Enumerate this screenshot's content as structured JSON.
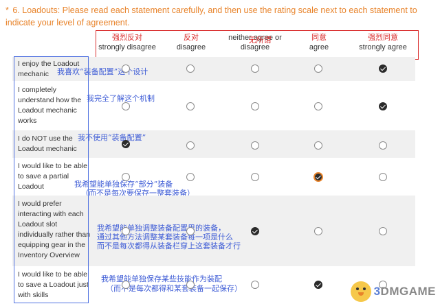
{
  "question": {
    "marker": "*",
    "text": "6. Loadouts: Please read each statement carefully, and then use the rating scale next to each statement to indicate your level of agreement."
  },
  "scale": [
    {
      "cn": "强烈反对",
      "en": "strongly disagree"
    },
    {
      "cn": "反对",
      "en": "disagree"
    },
    {
      "cn": "无所谓",
      "en": "neither agree or disagree"
    },
    {
      "cn": "同意",
      "en": "agree"
    },
    {
      "cn": "强烈同意",
      "en": "strongly agree"
    }
  ],
  "rows": [
    {
      "label": "I enjoy the Loadout mechanic",
      "cn": "我喜欢“装备配置”这个设计",
      "selected": 5
    },
    {
      "label": "I completely understand how the Loadout mechanic works",
      "cn": "我完全了解这个机制",
      "selected": 5
    },
    {
      "label": "I do NOT use the Loadout mechanic",
      "cn": "我不使用“装备配置”",
      "selected": 1
    },
    {
      "label": "I would like to be able to save a partial Loadout",
      "cn": "我希望能单独保存“部分”装备",
      "cn2": "（而不是每次要保存一整套装备）",
      "selected": 4
    },
    {
      "label": "I would prefer interacting with each Loadout slot individually rather than equipping gear in the Inventory Overview",
      "cn": "我希望能单独调整装备配置里的装备，",
      "cn2": "通过其他方法调整某套装备每一项是什么",
      "cn3": "而不是每次都得从装备栏穿上这套装备才行",
      "selected": 3
    },
    {
      "label": "I would like to be able to save a Loadout just with skills",
      "cn": "我希望能单独保存某些技能作为装配",
      "cn2": "（而不是每次都得和某套装备一起保存）",
      "selected": 4
    }
  ],
  "watermark": {
    "prefix": "3",
    "name": "DMGAME"
  }
}
